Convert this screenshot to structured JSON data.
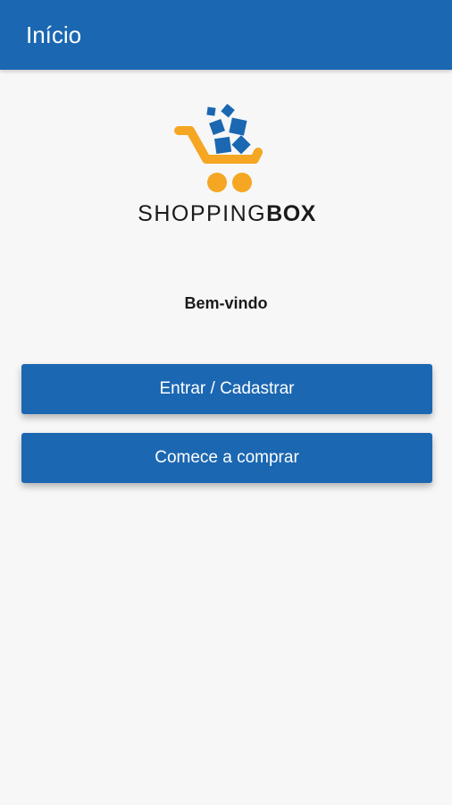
{
  "appbar": {
    "title": "Início"
  },
  "logo": {
    "text_light": "SHOPPING",
    "text_bold": "BOX",
    "cart_color": "#f5a623",
    "box_color": "#1b67b2"
  },
  "main": {
    "welcome": "Bem-vindo",
    "login_button": "Entrar / Cadastrar",
    "shop_button": "Comece a comprar"
  },
  "colors": {
    "primary": "#1b67b2",
    "background": "#f7f7f7"
  }
}
